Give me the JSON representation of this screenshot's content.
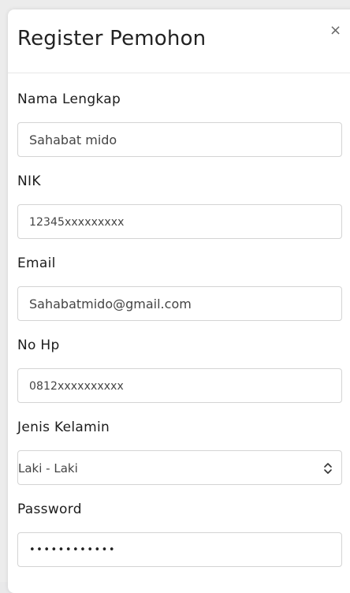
{
  "modal": {
    "title": "Register Pemohon",
    "close_label": "×"
  },
  "fields": {
    "nama": {
      "label": "Nama Lengkap",
      "value": "Sahabat mido"
    },
    "nik": {
      "label": "NIK",
      "value": "12345xxxxxxxxx"
    },
    "email": {
      "label": "Email",
      "value": "Sahabatmido@gmail.com"
    },
    "nohp": {
      "label": "No Hp",
      "value": "0812xxxxxxxxxx"
    },
    "gender": {
      "label": "Jenis Kelamin",
      "value": "Laki - Laki"
    },
    "password": {
      "label": "Password",
      "value": "••••••••••••"
    }
  }
}
